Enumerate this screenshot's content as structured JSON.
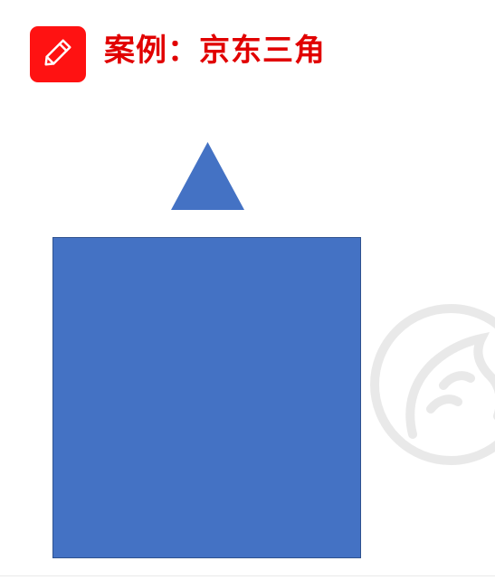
{
  "header": {
    "title": "案例：京东三角",
    "icon": "pencil-icon",
    "icon_bg_color": "#ff1212",
    "title_color": "#e10000"
  },
  "shapes": {
    "triangle": {
      "kind": "triangle",
      "fill_color": "#4472c4"
    },
    "square": {
      "kind": "rectangle",
      "fill_color": "#4472c4",
      "border_color": "#2f528f"
    }
  },
  "watermark": {
    "icon": "horse-head-logo"
  }
}
